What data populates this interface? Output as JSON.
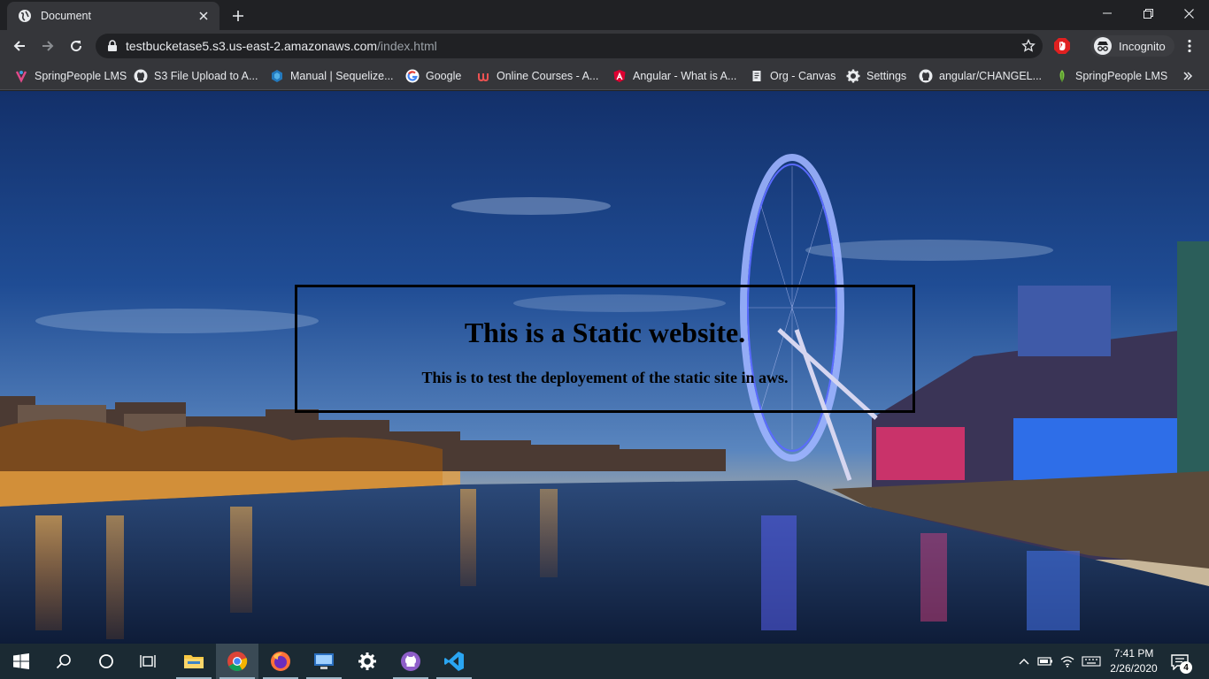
{
  "browser": {
    "tab": {
      "title": "Document"
    },
    "url": {
      "host": "testbucketase5.s3.us-east-2.amazonaws.com",
      "path": "/index.html"
    },
    "profile_label": "Incognito"
  },
  "bookmarks": [
    {
      "label": "SpringPeople LMS",
      "icon": "springpeople-icon"
    },
    {
      "label": "S3 File Upload to A...",
      "icon": "github-icon"
    },
    {
      "label": "Manual | Sequelize...",
      "icon": "sequelize-icon"
    },
    {
      "label": "Google",
      "icon": "google-icon"
    },
    {
      "label": "Online Courses - A...",
      "icon": "udemy-icon"
    },
    {
      "label": "Angular - What is A...",
      "icon": "angular-icon"
    },
    {
      "label": "Org - Canvas",
      "icon": "document-icon"
    },
    {
      "label": "Settings",
      "icon": "gear-icon"
    },
    {
      "label": "angular/CHANGEL...",
      "icon": "github-icon"
    },
    {
      "label": "SpringPeople LMS",
      "icon": "leaf-icon"
    }
  ],
  "page": {
    "heading": "This is a Static website.",
    "subheading": "This is to test the deployement of the static site in aws."
  },
  "taskbar": {
    "time": "7:41 PM",
    "date": "2/26/2020",
    "notification_count": "4"
  }
}
